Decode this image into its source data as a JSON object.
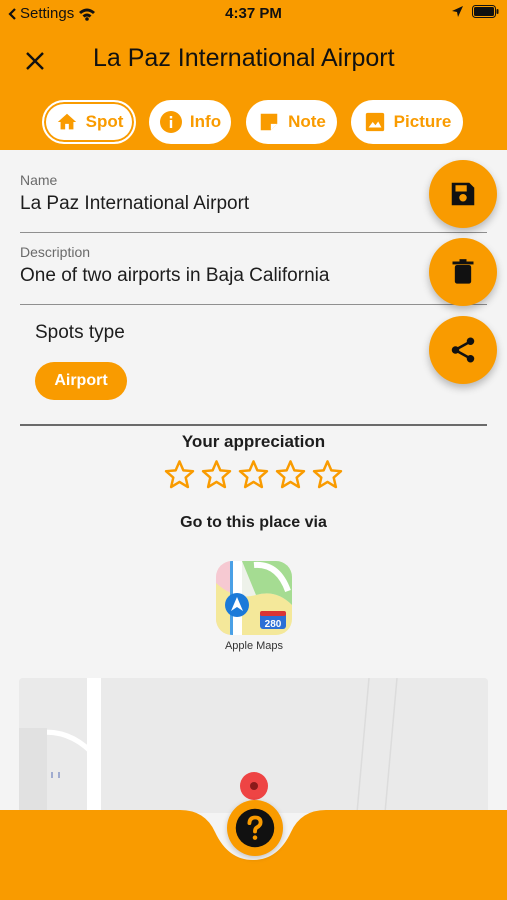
{
  "status_bar": {
    "back_app": "Settings",
    "time": "4:37 PM"
  },
  "header": {
    "title": "La Paz International Airport",
    "close_icon": "close-icon"
  },
  "tabs": [
    {
      "label": "Spot",
      "icon": "home-icon",
      "active": true
    },
    {
      "label": "Info",
      "icon": "info-icon",
      "active": false
    },
    {
      "label": "Note",
      "icon": "note-icon",
      "active": false
    },
    {
      "label": "Picture",
      "icon": "image-icon",
      "active": false
    }
  ],
  "form": {
    "name_label": "Name",
    "name_value": "La Paz International Airport",
    "description_label": "Description",
    "description_value": "One of two airports in Baja California",
    "spots_type_label": "Spots type",
    "spots_type_chip": "Airport"
  },
  "appreciation": {
    "label": "Your appreciation",
    "rating": 0,
    "max": 5
  },
  "navigation": {
    "label": "Go to this place via",
    "apps": [
      {
        "name": "Apple Maps",
        "badge": "280"
      }
    ]
  },
  "fabs": [
    {
      "icon": "save-icon"
    },
    {
      "icon": "delete-icon"
    },
    {
      "icon": "share-icon"
    }
  ],
  "bottom": {
    "help_icon": "help-icon"
  },
  "colors": {
    "accent": "#f99b00",
    "background": "#f4f4f4",
    "text": "#1d1d1d"
  }
}
